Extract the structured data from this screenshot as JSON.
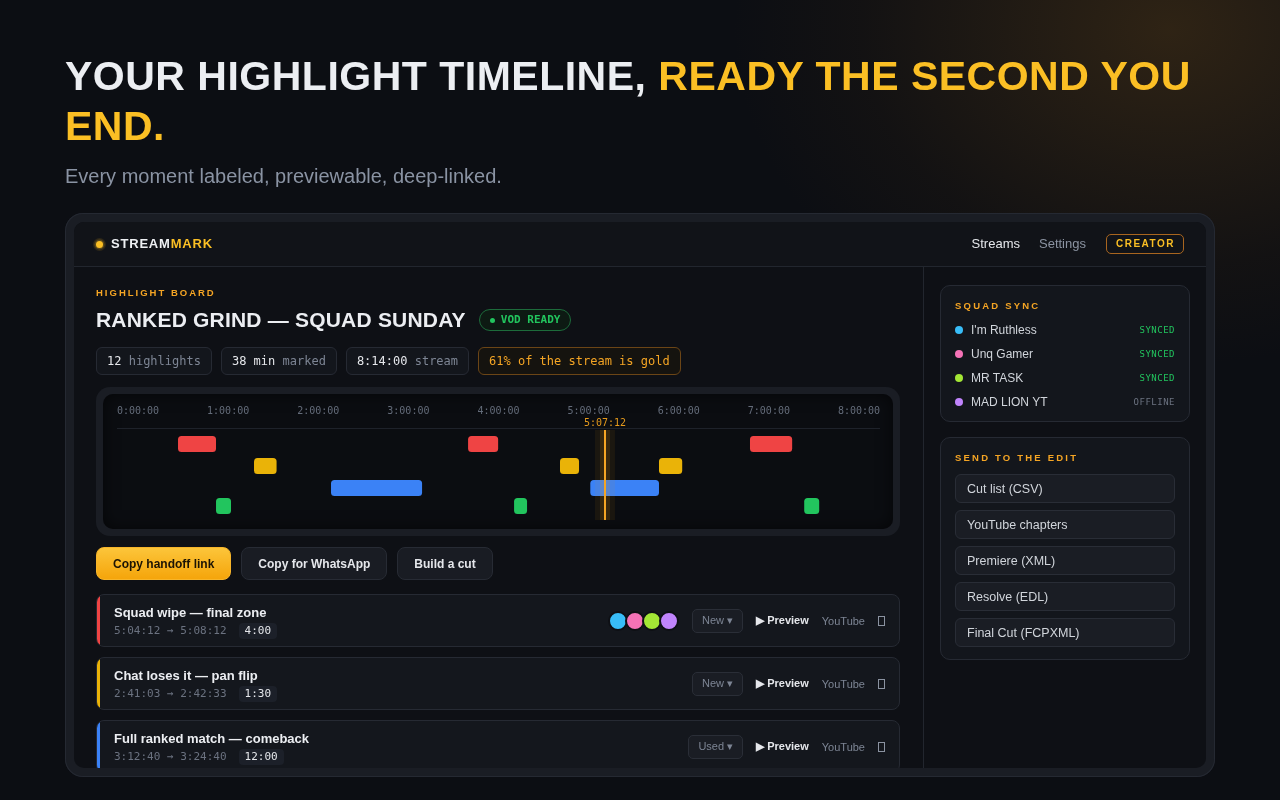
{
  "hero": {
    "headline": "YOUR HIGHLIGHT TIMELINE,",
    "headline_accent": "READY THE SECOND YOU END.",
    "subtitle": "Every moment labeled, previewable, deep-linked."
  },
  "app": {
    "logo": {
      "text": "STREAM",
      "accent": "MARK"
    },
    "nav": [
      {
        "label": "Streams",
        "selected": true
      },
      {
        "label": "Settings",
        "selected": false
      }
    ],
    "role_badge": "CREATOR",
    "board": {
      "eyebrow": "HIGHLIGHT BOARD",
      "title": "RANKED GRIND — SQUAD SUNDAY",
      "status_badge": "VOD READY",
      "stats": [
        {
          "kind": "stat",
          "value": "12",
          "label": "highlights"
        },
        {
          "kind": "stat",
          "value": "38 min",
          "label": "marked"
        },
        {
          "kind": "stat",
          "value": "8:14:00",
          "label": "stream"
        },
        {
          "kind": "accent",
          "label": "61% of the stream is gold"
        }
      ]
    },
    "timeline": {
      "ticks": [
        "0:00:00",
        "1:00:00",
        "2:00:00",
        "3:00:00",
        "4:00:00",
        "5:00:00",
        "6:00:00",
        "7:00:00",
        "8:00:00"
      ],
      "playhead": "5:07:12"
    },
    "actions": [
      {
        "label": "Copy handoff link",
        "primary": true
      },
      {
        "label": "Copy for WhatsApp",
        "primary": false
      },
      {
        "label": "Build a cut",
        "primary": false
      }
    ],
    "clips": [
      {
        "title": "Squad wipe — final zone",
        "range": "5:04:12 → 5:08:12",
        "duration": "4:00",
        "color": "#ef4444",
        "avatars": [
          {
            "color": "#38bdf8"
          },
          {
            "color": "#f472b6"
          },
          {
            "color": "#a3e635"
          },
          {
            "color": "#c084fc"
          }
        ],
        "status": "New ▾",
        "preview": "▶ Preview",
        "platform": "YouTube"
      },
      {
        "title": "Chat loses it — pan flip",
        "range": "2:41:03 → 2:42:33",
        "duration": "1:30",
        "color": "#eab308",
        "status": "New ▾",
        "preview": "▶ Preview",
        "platform": "YouTube"
      },
      {
        "title": "Full ranked match — comeback",
        "range": "3:12:40 → 3:24:40",
        "duration": "12:00",
        "color": "#3b82f6",
        "status": "Used ▾",
        "preview": "▶ Preview",
        "platform": "YouTube"
      }
    ],
    "squad_sync": {
      "title": "SQUAD SYNC",
      "members": [
        {
          "name": "I'm Ruthless",
          "color": "#38bdf8",
          "status": "SYNCED",
          "synced": true
        },
        {
          "name": "Unq Gamer",
          "color": "#f472b6",
          "status": "SYNCED",
          "synced": true
        },
        {
          "name": "MR TASK",
          "color": "#a3e635",
          "status": "SYNCED",
          "synced": true
        },
        {
          "name": "MAD LION YT",
          "color": "#c084fc",
          "status": "OFFLINE",
          "synced": false
        }
      ]
    },
    "export": {
      "title": "SEND TO THE EDIT",
      "options": [
        "Cut list (CSV)",
        "YouTube chapters",
        "Premiere (XML)",
        "Resolve (EDL)",
        "Final Cut (FCPXML)"
      ]
    }
  }
}
